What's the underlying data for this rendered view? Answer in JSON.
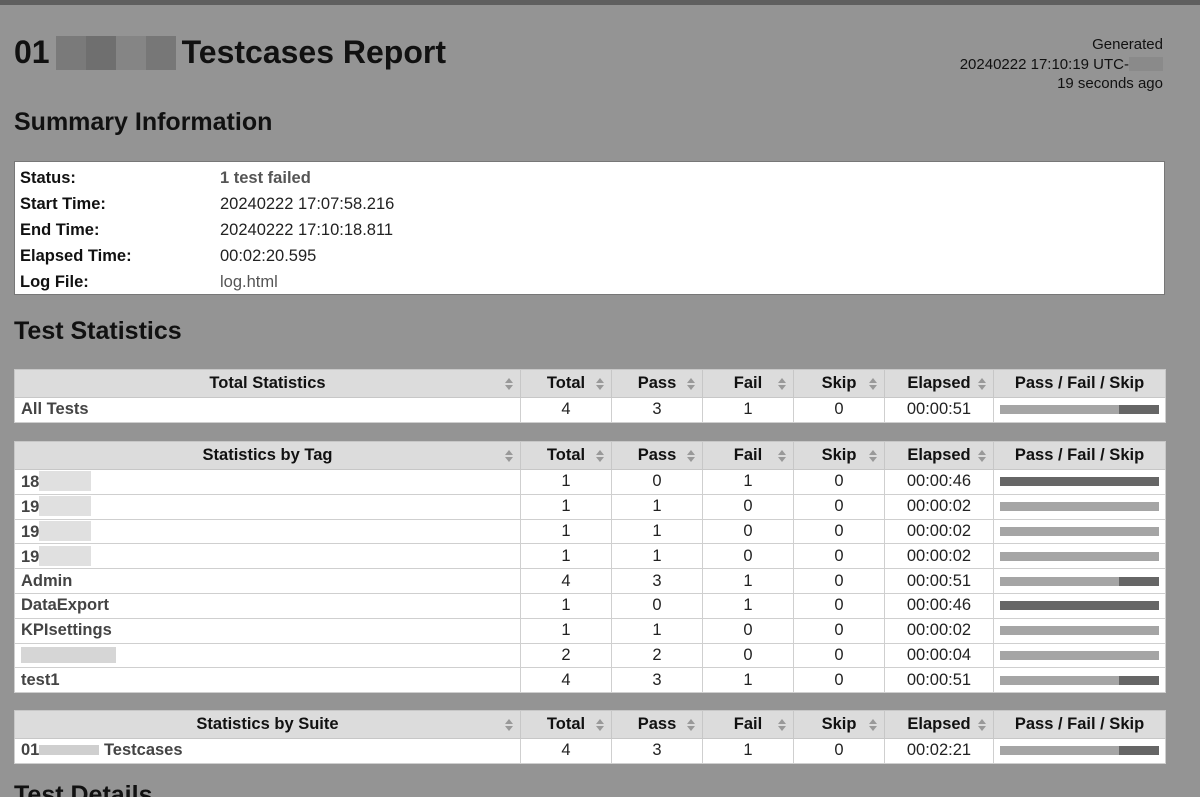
{
  "header": {
    "title_prefix": "01",
    "title_suffix": "Testcases Report",
    "generated_label": "Generated",
    "generated_time": "20240222 17:10:19 UTC-",
    "generated_ago": "19 seconds ago"
  },
  "summary": {
    "heading": "Summary Information",
    "rows": [
      {
        "label": "Status:",
        "value": "1 test failed"
      },
      {
        "label": "Start Time:",
        "value": "20240222 17:07:58.216"
      },
      {
        "label": "End Time:",
        "value": "20240222 17:10:18.811"
      },
      {
        "label": "Elapsed Time:",
        "value": "00:02:20.595"
      },
      {
        "label": "Log File:",
        "value": "log.html"
      }
    ]
  },
  "statistics": {
    "heading": "Test Statistics",
    "columns": {
      "total": "Total",
      "pass": "Pass",
      "fail": "Fail",
      "skip": "Skip",
      "elapsed": "Elapsed",
      "bar": "Pass / Fail / Skip"
    },
    "total_table": {
      "title": "Total Statistics",
      "rows": [
        {
          "name": "All Tests",
          "total": "4",
          "pass": "3",
          "fail": "1",
          "skip": "0",
          "elapsed": "00:00:51",
          "pass_frac": 0.75,
          "fail_frac": 0.25
        }
      ]
    },
    "tag_table": {
      "title": "Statistics by Tag",
      "rows": [
        {
          "name": "18",
          "total": "1",
          "pass": "0",
          "fail": "1",
          "skip": "0",
          "elapsed": "00:00:46",
          "pass_frac": 0,
          "fail_frac": 1
        },
        {
          "name": "19",
          "total": "1",
          "pass": "1",
          "fail": "0",
          "skip": "0",
          "elapsed": "00:00:02",
          "pass_frac": 1,
          "fail_frac": 0
        },
        {
          "name": "19",
          "total": "1",
          "pass": "1",
          "fail": "0",
          "skip": "0",
          "elapsed": "00:00:02",
          "pass_frac": 1,
          "fail_frac": 0
        },
        {
          "name": "19",
          "total": "1",
          "pass": "1",
          "fail": "0",
          "skip": "0",
          "elapsed": "00:00:02",
          "pass_frac": 1,
          "fail_frac": 0
        },
        {
          "name": "Admin",
          "total": "4",
          "pass": "3",
          "fail": "1",
          "skip": "0",
          "elapsed": "00:00:51",
          "pass_frac": 0.75,
          "fail_frac": 0.25
        },
        {
          "name": "DataExport",
          "total": "1",
          "pass": "0",
          "fail": "1",
          "skip": "0",
          "elapsed": "00:00:46",
          "pass_frac": 0,
          "fail_frac": 1
        },
        {
          "name": "KPIsettings",
          "total": "1",
          "pass": "1",
          "fail": "0",
          "skip": "0",
          "elapsed": "00:00:02",
          "pass_frac": 1,
          "fail_frac": 0
        },
        {
          "name": "",
          "total": "2",
          "pass": "2",
          "fail": "0",
          "skip": "0",
          "elapsed": "00:00:04",
          "pass_frac": 1,
          "fail_frac": 0
        },
        {
          "name": "test1",
          "total": "4",
          "pass": "3",
          "fail": "1",
          "skip": "0",
          "elapsed": "00:00:51",
          "pass_frac": 0.75,
          "fail_frac": 0.25
        }
      ]
    },
    "suite_table": {
      "title": "Statistics by Suite",
      "rows": [
        {
          "name_prefix": "01",
          "name_suffix": " Testcases",
          "total": "4",
          "pass": "3",
          "fail": "1",
          "skip": "0",
          "elapsed": "00:02:21",
          "pass_frac": 0.75,
          "fail_frac": 0.25
        }
      ]
    }
  },
  "details": {
    "heading": "Test Details"
  }
}
